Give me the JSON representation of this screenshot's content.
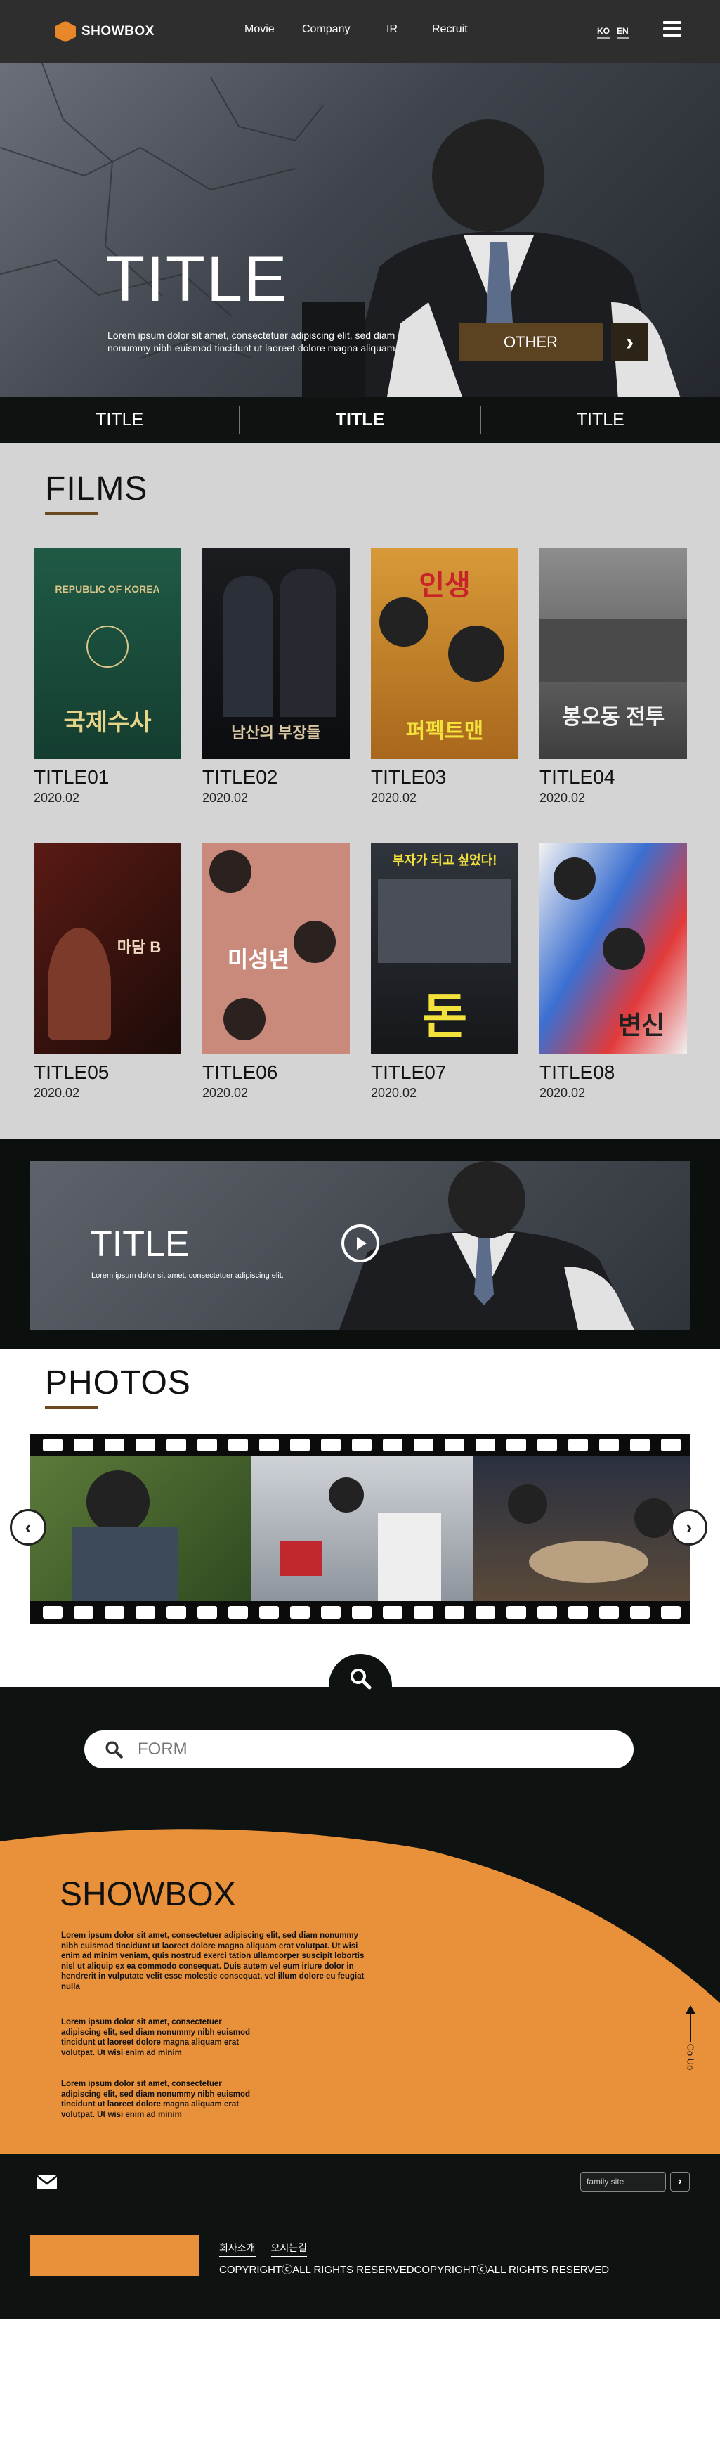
{
  "header": {
    "logo_text": "SHOWBOX",
    "nav": [
      "Movie",
      "Company",
      "IR",
      "Recruit"
    ],
    "lang": [
      "KO",
      "EN"
    ]
  },
  "hero": {
    "title": "TITLE",
    "description": "Lorem ipsum dolor sit amet, consectetuer adipiscing elit, sed diam nonummy nibh euismod tincidunt ut laoreet dolore magna aliquam",
    "other_label": "OTHER"
  },
  "tabs": [
    "TITLE",
    "TITLE",
    "TITLE"
  ],
  "films": {
    "title": "FILMS",
    "items": [
      {
        "name": "TITLE01",
        "date": "2020.02",
        "poster_text": "국제수사"
      },
      {
        "name": "TITLE02",
        "date": "2020.02",
        "poster_text": "남산의 부장들"
      },
      {
        "name": "TITLE03",
        "date": "2020.02",
        "poster_text": "퍼펙트맨"
      },
      {
        "name": "TITLE04",
        "date": "2020.02",
        "poster_text": "봉오동 전투"
      },
      {
        "name": "TITLE05",
        "date": "2020.02",
        "poster_text": "마담 B"
      },
      {
        "name": "TITLE06",
        "date": "2020.02",
        "poster_text": "미성년"
      },
      {
        "name": "TITLE07",
        "date": "2020.02",
        "poster_text": "돈"
      },
      {
        "name": "TITLE08",
        "date": "2020.02",
        "poster_text": "변신"
      }
    ]
  },
  "video": {
    "title": "TITLE",
    "description": "Lorem ipsum dolor sit amet, consectetuer adipiscing elit."
  },
  "photos": {
    "title": "PHOTOS"
  },
  "search": {
    "placeholder": "FORM"
  },
  "company": {
    "title": "SHOWBOX",
    "para1": "Lorem ipsum dolor sit amet, consectetuer adipiscing elit, sed diam nonummy nibh euismod tincidunt ut laoreet dolore magna aliquam erat volutpat. Ut wisi enim ad minim veniam, quis nostrud exerci tation ullamcorper suscipit lobortis nisl ut aliquip ex ea commodo consequat. Duis autem vel eum iriure dolor in hendrerit in vulputate velit esse molestie consequat, vel illum dolore eu feugiat nulla",
    "para2": "Lorem ipsum dolor sit amet, consectetuer adipiscing elit, sed diam nonummy nibh euismod tincidunt ut laoreet dolore magna aliquam erat volutpat. Ut wisi enim ad minim",
    "para3": "Lorem ipsum dolor sit amet, consectetuer adipiscing elit, sed diam nonummy nibh euismod tincidunt ut laoreet dolore magna aliquam erat volutpat. Ut wisi enim ad minim",
    "up_label": "Go Up"
  },
  "footer": {
    "family_site": "family site",
    "links": [
      "회사소개",
      "오시는길"
    ],
    "copyright": "COPYRIGHTⓒALL RIGHTS RESERVEDCOPYRIGHTⓒALL RIGHTS RESERVED"
  },
  "colors": {
    "accent_orange": "#e8913a",
    "brown": "#5b4221",
    "dark": "#0e1211"
  }
}
